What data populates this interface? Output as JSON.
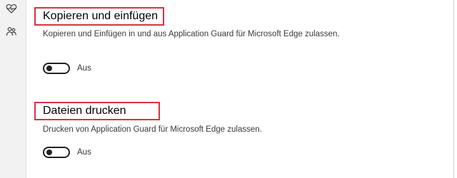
{
  "left_rail": {
    "icons": [
      "heart-pulse-icon",
      "family-icon"
    ]
  },
  "sections": [
    {
      "title": "Kopieren und einfügen",
      "description": "Kopieren und Einfügen in und aus Application Guard für Microsoft Edge zulassen.",
      "toggle_state": "Aus",
      "toggle_on": false
    },
    {
      "title": "Dateien drucken",
      "description": "Drucken von Application Guard für Microsoft Edge zulassen.",
      "toggle_state": "Aus",
      "toggle_on": false
    }
  ],
  "colors": {
    "highlight": "#d9333f",
    "rail_background": "#f2f2f2",
    "toggle_off": "#222222"
  }
}
